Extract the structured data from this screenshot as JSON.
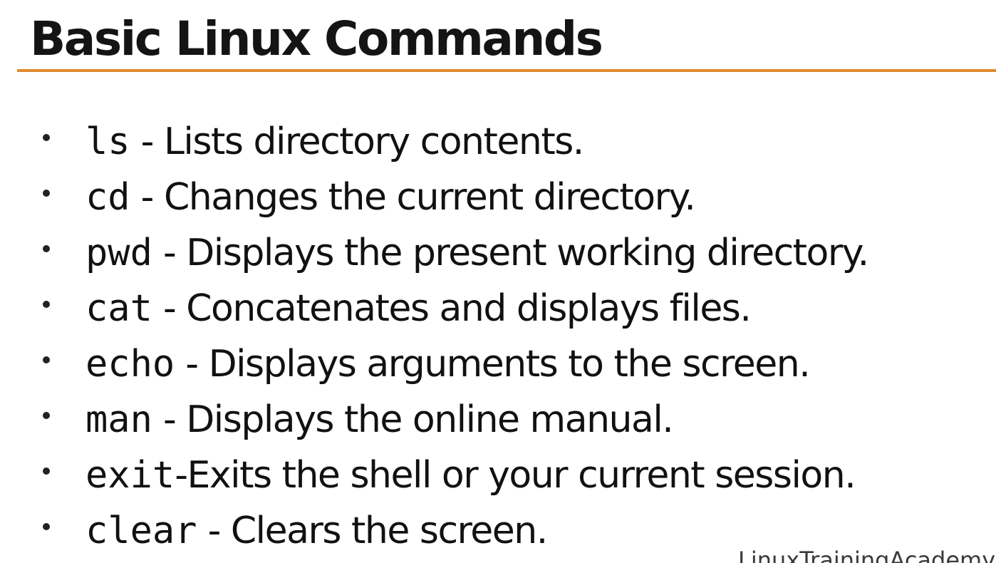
{
  "title": "Basic Linux Commands",
  "colors": {
    "accent_rule": "#e08a2c",
    "text": "#111111"
  },
  "commands": [
    {
      "cmd": "ls",
      "sep": " - ",
      "desc": " Lists directory contents."
    },
    {
      "cmd": "cd",
      "sep": " - ",
      "desc": "Changes the current directory."
    },
    {
      "cmd": "pwd",
      "sep": " - ",
      "desc": "Displays the present working directory."
    },
    {
      "cmd": "cat",
      "sep": " - ",
      "desc": "Concatenates and displays files."
    },
    {
      "cmd": "echo",
      "sep": " - ",
      "desc": "Displays arguments to the screen."
    },
    {
      "cmd": "man",
      "sep": " - ",
      "desc": "Displays the online manual."
    },
    {
      "cmd": "exit",
      "sep": "-",
      "desc": "Exits the shell or your current session."
    },
    {
      "cmd": "clear",
      "sep": " - ",
      "desc": "Clears the screen."
    }
  ],
  "watermark": "LinuxTrainingAcademy"
}
